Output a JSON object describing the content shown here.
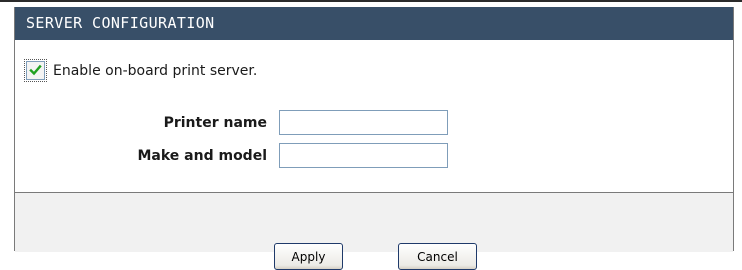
{
  "panel": {
    "title": "SERVER CONFIGURATION"
  },
  "print_server": {
    "checkbox_label": "Enable on-board print server.",
    "checked": true
  },
  "fields": [
    {
      "label": "Printer name",
      "value": ""
    },
    {
      "label": "Make and model",
      "value": ""
    }
  ],
  "buttons": {
    "apply": "Apply",
    "cancel": "Cancel"
  },
  "colors": {
    "header_bg": "#384f68",
    "footer_bg": "#f1f1f1",
    "check_mark": "#21a121"
  },
  "icons": {
    "checkbox": "check-icon"
  }
}
